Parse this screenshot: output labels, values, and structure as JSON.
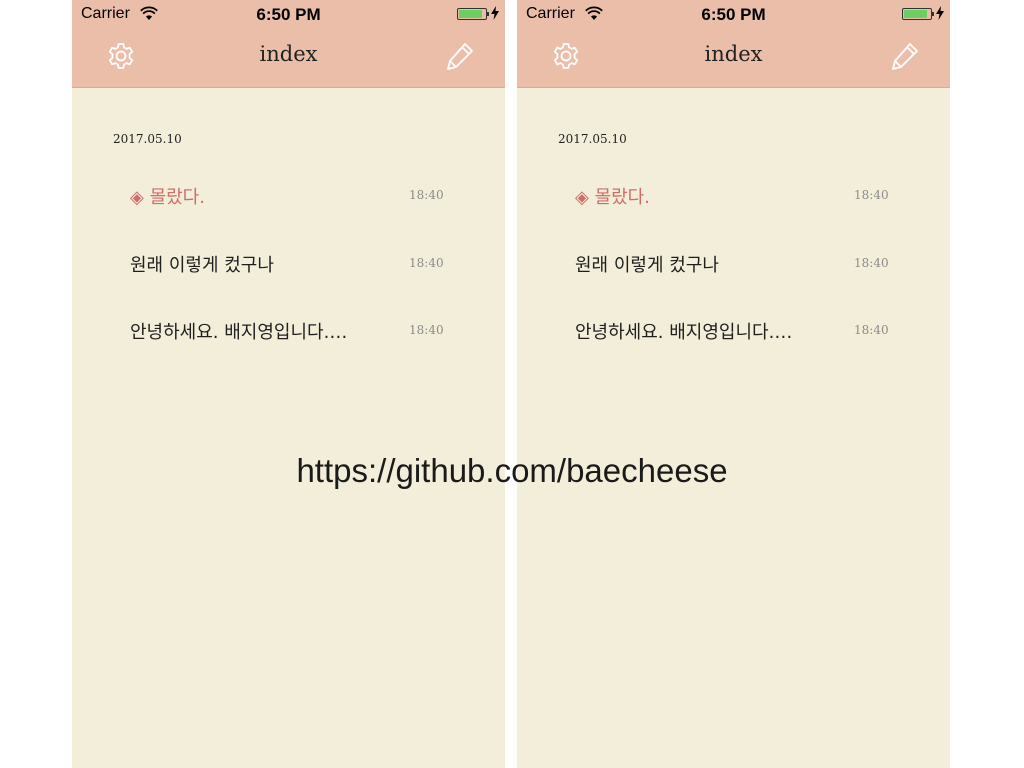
{
  "colors": {
    "header_background": "#ebbeaa",
    "page_background": "#f2eed9",
    "accent": "#cf6d6b",
    "timestamp": "#8c8c8c",
    "battery": "#6fce63"
  },
  "icons": [
    "wifi-icon",
    "battery-icon",
    "charging-bolt-icon",
    "settings-gear-icon",
    "pencil-icon"
  ],
  "status_bar": {
    "carrier": "Carrier",
    "time": "6:50 PM",
    "battery_fraction": 0.9
  },
  "nav": {
    "title": "index"
  },
  "list": {
    "date": "2017.05.10",
    "notes": [
      {
        "title": "◈ 몰랐다.",
        "time": "18:40",
        "highlighted": true
      },
      {
        "title": "원래 이렇게 컸구나",
        "time": "18:40",
        "highlighted": false
      },
      {
        "title": "안녕하세요. 배지영입니다.…",
        "time": "18:40",
        "highlighted": false
      }
    ]
  },
  "caption": "https://github.com/baecheese"
}
